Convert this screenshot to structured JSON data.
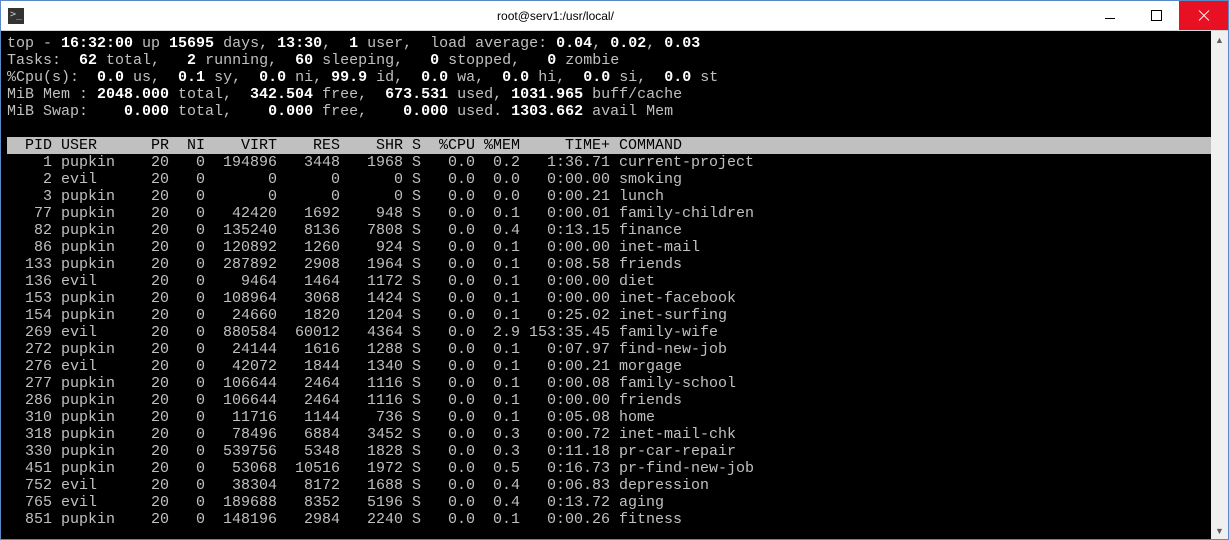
{
  "window": {
    "title": "root@serv1:/usr/local/"
  },
  "summary": {
    "line1_prefix": "top - ",
    "time": "16:32:00",
    "up_prefix": " up ",
    "up_days": "15695",
    "up_suffix": " days, ",
    "up_hm": "13:30",
    "users_sep": ",  ",
    "users_n": "1",
    "users_label": " user,  load average: ",
    "la1": "0.04",
    "la_sep": ", ",
    "la2": "0.02",
    "la3": "0.03",
    "tasks_label": "Tasks: ",
    "tasks_total": " 62",
    "tasks_total_l": " total,   ",
    "tasks_run": "2",
    "tasks_run_l": " running,  ",
    "tasks_sleep": "60",
    "tasks_sleep_l": " sleeping,   ",
    "tasks_stop": "0",
    "tasks_stop_l": " stopped,   ",
    "tasks_zom": "0",
    "tasks_zom_l": " zombie",
    "cpu_label": "%Cpu(s):  ",
    "cpu_us": "0.0",
    "cpu_us_l": " us,  ",
    "cpu_sy": "0.1",
    "cpu_sy_l": " sy,  ",
    "cpu_ni": "0.0",
    "cpu_ni_l": " ni, ",
    "cpu_id": "99.9",
    "cpu_id_l": " id,  ",
    "cpu_wa": "0.0",
    "cpu_wa_l": " wa,  ",
    "cpu_hi": "0.0",
    "cpu_hi_l": " hi,  ",
    "cpu_si": "0.0",
    "cpu_si_l": " si,  ",
    "cpu_st": "0.0",
    "cpu_st_l": " st",
    "mem_label": "MiB Mem : ",
    "mem_tot": "2048.000",
    "mem_tot_l": " total,  ",
    "mem_free": "342.504",
    "mem_free_l": " free,  ",
    "mem_used": "673.531",
    "mem_used_l": " used, ",
    "mem_buff": "1031.965",
    "mem_buff_l": " buff/cache",
    "swap_label": "MiB Swap:    ",
    "swap_tot": "0.000",
    "swap_tot_l": " total,    ",
    "swap_free": "0.000",
    "swap_free_l": " free,    ",
    "swap_used": "0.000",
    "swap_used_l": " used. ",
    "swap_avail": "1303.662",
    "swap_avail_l": " avail Mem"
  },
  "columns": {
    "pid": "PID",
    "user": "USER",
    "pr": "PR",
    "ni": "NI",
    "virt": "VIRT",
    "res": "RES",
    "shr": "SHR",
    "s": "S",
    "cpu": "%CPU",
    "mem": "%MEM",
    "time": "TIME+",
    "cmd": "COMMAND"
  },
  "processes": [
    {
      "pid": "1",
      "user": "pupkin",
      "pr": "20",
      "ni": "0",
      "virt": "194896",
      "res": "3448",
      "shr": "1968",
      "s": "S",
      "cpu": "0.0",
      "mem": "0.2",
      "time": "1:36.71",
      "cmd": "current-project"
    },
    {
      "pid": "2",
      "user": "evil",
      "pr": "20",
      "ni": "0",
      "virt": "0",
      "res": "0",
      "shr": "0",
      "s": "S",
      "cpu": "0.0",
      "mem": "0.0",
      "time": "0:00.00",
      "cmd": "smoking"
    },
    {
      "pid": "3",
      "user": "pupkin",
      "pr": "20",
      "ni": "0",
      "virt": "0",
      "res": "0",
      "shr": "0",
      "s": "S",
      "cpu": "0.0",
      "mem": "0.0",
      "time": "0:00.21",
      "cmd": "lunch"
    },
    {
      "pid": "77",
      "user": "pupkin",
      "pr": "20",
      "ni": "0",
      "virt": "42420",
      "res": "1692",
      "shr": "948",
      "s": "S",
      "cpu": "0.0",
      "mem": "0.1",
      "time": "0:00.01",
      "cmd": "family-children"
    },
    {
      "pid": "82",
      "user": "pupkin",
      "pr": "20",
      "ni": "0",
      "virt": "135240",
      "res": "8136",
      "shr": "7808",
      "s": "S",
      "cpu": "0.0",
      "mem": "0.4",
      "time": "0:13.15",
      "cmd": "finance"
    },
    {
      "pid": "86",
      "user": "pupkin",
      "pr": "20",
      "ni": "0",
      "virt": "120892",
      "res": "1260",
      "shr": "924",
      "s": "S",
      "cpu": "0.0",
      "mem": "0.1",
      "time": "0:00.00",
      "cmd": "inet-mail"
    },
    {
      "pid": "133",
      "user": "pupkin",
      "pr": "20",
      "ni": "0",
      "virt": "287892",
      "res": "2908",
      "shr": "1964",
      "s": "S",
      "cpu": "0.0",
      "mem": "0.1",
      "time": "0:08.58",
      "cmd": "friends"
    },
    {
      "pid": "136",
      "user": "evil",
      "pr": "20",
      "ni": "0",
      "virt": "9464",
      "res": "1464",
      "shr": "1172",
      "s": "S",
      "cpu": "0.0",
      "mem": "0.1",
      "time": "0:00.00",
      "cmd": "diet"
    },
    {
      "pid": "153",
      "user": "pupkin",
      "pr": "20",
      "ni": "0",
      "virt": "108964",
      "res": "3068",
      "shr": "1424",
      "s": "S",
      "cpu": "0.0",
      "mem": "0.1",
      "time": "0:00.00",
      "cmd": "inet-facebook"
    },
    {
      "pid": "154",
      "user": "pupkin",
      "pr": "20",
      "ni": "0",
      "virt": "24660",
      "res": "1820",
      "shr": "1204",
      "s": "S",
      "cpu": "0.0",
      "mem": "0.1",
      "time": "0:25.02",
      "cmd": "inet-surfing"
    },
    {
      "pid": "269",
      "user": "evil",
      "pr": "20",
      "ni": "0",
      "virt": "880584",
      "res": "60012",
      "shr": "4364",
      "s": "S",
      "cpu": "0.0",
      "mem": "2.9",
      "time": "153:35.45",
      "cmd": "family-wife"
    },
    {
      "pid": "272",
      "user": "pupkin",
      "pr": "20",
      "ni": "0",
      "virt": "24144",
      "res": "1616",
      "shr": "1288",
      "s": "S",
      "cpu": "0.0",
      "mem": "0.1",
      "time": "0:07.97",
      "cmd": "find-new-job"
    },
    {
      "pid": "276",
      "user": "evil",
      "pr": "20",
      "ni": "0",
      "virt": "42072",
      "res": "1844",
      "shr": "1340",
      "s": "S",
      "cpu": "0.0",
      "mem": "0.1",
      "time": "0:00.21",
      "cmd": "morgage"
    },
    {
      "pid": "277",
      "user": "pupkin",
      "pr": "20",
      "ni": "0",
      "virt": "106644",
      "res": "2464",
      "shr": "1116",
      "s": "S",
      "cpu": "0.0",
      "mem": "0.1",
      "time": "0:00.08",
      "cmd": "family-school"
    },
    {
      "pid": "286",
      "user": "pupkin",
      "pr": "20",
      "ni": "0",
      "virt": "106644",
      "res": "2464",
      "shr": "1116",
      "s": "S",
      "cpu": "0.0",
      "mem": "0.1",
      "time": "0:00.00",
      "cmd": "friends"
    },
    {
      "pid": "310",
      "user": "pupkin",
      "pr": "20",
      "ni": "0",
      "virt": "11716",
      "res": "1144",
      "shr": "736",
      "s": "S",
      "cpu": "0.0",
      "mem": "0.1",
      "time": "0:05.08",
      "cmd": "home"
    },
    {
      "pid": "318",
      "user": "pupkin",
      "pr": "20",
      "ni": "0",
      "virt": "78496",
      "res": "6884",
      "shr": "3452",
      "s": "S",
      "cpu": "0.0",
      "mem": "0.3",
      "time": "0:00.72",
      "cmd": "inet-mail-chk"
    },
    {
      "pid": "330",
      "user": "pupkin",
      "pr": "20",
      "ni": "0",
      "virt": "539756",
      "res": "5348",
      "shr": "1828",
      "s": "S",
      "cpu": "0.0",
      "mem": "0.3",
      "time": "0:11.18",
      "cmd": "pr-car-repair"
    },
    {
      "pid": "451",
      "user": "pupkin",
      "pr": "20",
      "ni": "0",
      "virt": "53068",
      "res": "10516",
      "shr": "1972",
      "s": "S",
      "cpu": "0.0",
      "mem": "0.5",
      "time": "0:16.73",
      "cmd": "pr-find-new-job"
    },
    {
      "pid": "752",
      "user": "evil",
      "pr": "20",
      "ni": "0",
      "virt": "38304",
      "res": "8172",
      "shr": "1688",
      "s": "S",
      "cpu": "0.0",
      "mem": "0.4",
      "time": "0:06.83",
      "cmd": "depression"
    },
    {
      "pid": "765",
      "user": "evil",
      "pr": "20",
      "ni": "0",
      "virt": "189688",
      "res": "8352",
      "shr": "5196",
      "s": "S",
      "cpu": "0.0",
      "mem": "0.4",
      "time": "0:13.72",
      "cmd": "aging"
    },
    {
      "pid": "851",
      "user": "pupkin",
      "pr": "20",
      "ni": "0",
      "virt": "148196",
      "res": "2984",
      "shr": "2240",
      "s": "S",
      "cpu": "0.0",
      "mem": "0.1",
      "time": "0:00.26",
      "cmd": "fitness"
    }
  ]
}
